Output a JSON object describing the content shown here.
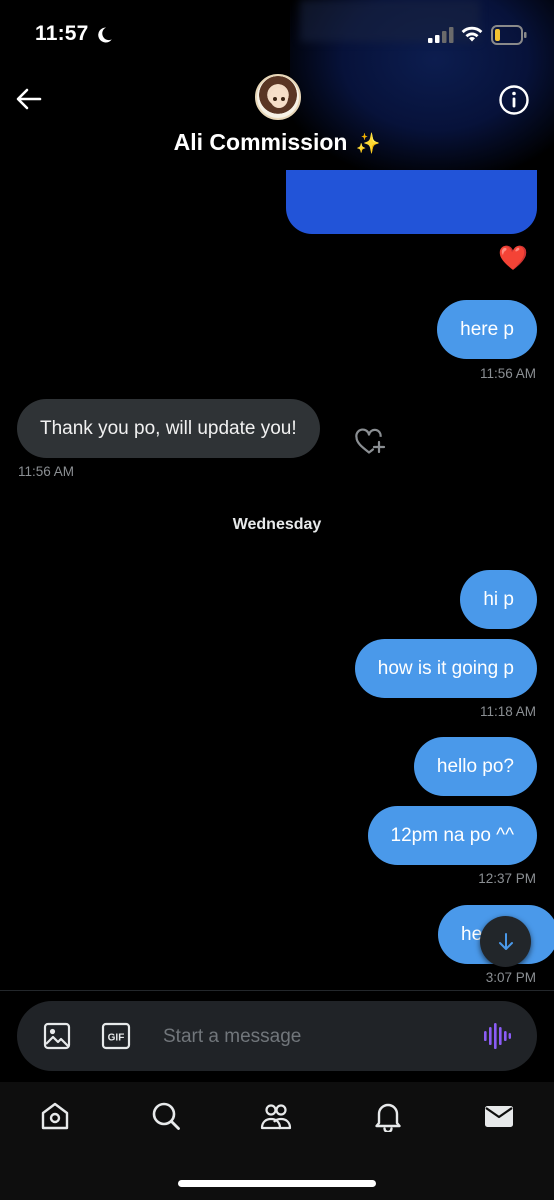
{
  "status_bar": {
    "time": "11:57"
  },
  "header": {
    "back_label": "Back",
    "contact_name": "Ali Commission",
    "sparkle": "✨"
  },
  "messages": {
    "m1": {
      "text": "here p",
      "time": "11:56 AM"
    },
    "m2": {
      "text": "Thank you po, will update you!",
      "time": "11:56 AM"
    },
    "day_separator": "Wednesday",
    "m3": {
      "text": "hi p"
    },
    "m4": {
      "text": "how is it going p",
      "time": "11:18 AM"
    },
    "m5": {
      "text": "hello po?"
    },
    "m6": {
      "text": "12pm na po ^^",
      "time": "12:37 PM"
    },
    "m7": {
      "text": "he",
      "time": "3:07 PM"
    }
  },
  "reaction": {
    "emoji": "❤️"
  },
  "composer": {
    "placeholder": "Start a message",
    "gif_label": "GIF"
  },
  "tabs": [
    "home",
    "search",
    "communities",
    "notifications",
    "messages"
  ],
  "colors": {
    "outgoing": "#4a99ea",
    "incoming": "#2f3336",
    "accent_voice": "#8b5cf6",
    "reaction": "#e02d3c"
  }
}
